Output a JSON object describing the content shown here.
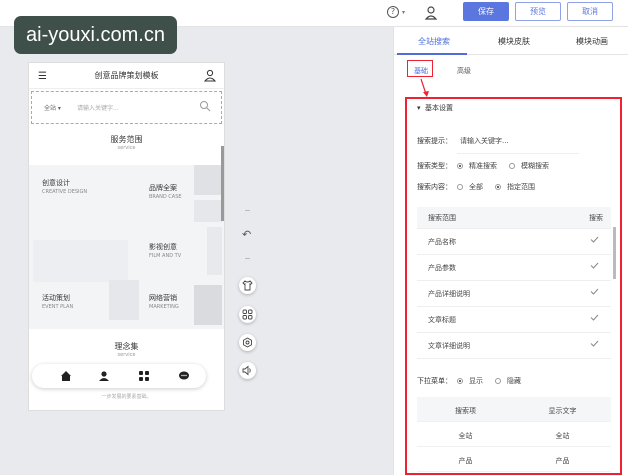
{
  "watermark": "ai-youxi.com.cn",
  "topbar": {
    "help": "?",
    "save": "保存",
    "preview": "预览",
    "cancel": "取消"
  },
  "phone": {
    "title": "创意品牌策划模板",
    "search_scope": "全站",
    "search_placeholder": "请输入关键字...",
    "section_title": "服务范围",
    "section_sub": "service",
    "cells": [
      {
        "name": "创意设计",
        "en": "CREATIVE DESIGN"
      },
      {
        "name": "品牌全案",
        "en": "BRAND CASE"
      },
      {
        "name": "影视创意",
        "en": "FILM AND TV"
      },
      {
        "name": "活动策划",
        "en": "EVENT PLAN"
      },
      {
        "name": "网络营销",
        "en": "MARKETING"
      }
    ],
    "idea_title": "理念集",
    "idea_sub": "service",
    "footer_text": "一步发展的要素基础。"
  },
  "panel": {
    "tabs": [
      "全站搜索",
      "模块皮肤",
      "模块动画"
    ],
    "subtabs": [
      "基础",
      "高级"
    ],
    "section": "基本设置",
    "prompt_label": "搜索提示：",
    "prompt_value": "请输入关键字...",
    "type_label": "搜索类型：",
    "type_options": [
      "精准搜索",
      "模糊搜索"
    ],
    "content_label": "搜索内容：",
    "content_options": [
      "全部",
      "指定范围"
    ],
    "table_headers": [
      "搜索范围",
      "搜索"
    ],
    "table_rows": [
      "产品名称",
      "产品参数",
      "产品详细说明",
      "文章标题",
      "文章详细说明"
    ],
    "dropdown_label": "下拉菜单：",
    "dropdown_options": [
      "显示",
      "隐藏"
    ],
    "table2_headers": [
      "搜索项",
      "显示文字"
    ],
    "table2_rows": [
      [
        "全站",
        "全站"
      ],
      [
        "产品",
        "产品"
      ]
    ]
  },
  "colors": {
    "accent": "#5b76de",
    "highlight": "#e22233"
  }
}
